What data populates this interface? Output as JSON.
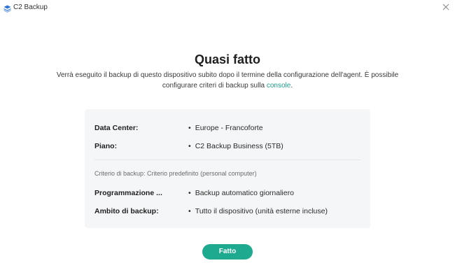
{
  "window": {
    "title": "C2 Backup",
    "app_icon": "stack-layers-icon",
    "close_icon": "close-icon"
  },
  "main": {
    "heading": "Quasi fatto",
    "subtitle_text": "Verrà eseguito il backup di questo dispositivo subito dopo il termine della configurazione dell'agent. È possibile configurare criteri di backup sulla ",
    "subtitle_link": "console",
    "subtitle_end": "."
  },
  "summary": {
    "rows_top": [
      {
        "label": "Data Center:",
        "value": "Europe - Francoforte"
      },
      {
        "label": "Piano:",
        "value": "C2 Backup Business (5TB)"
      }
    ],
    "criterion": "Criterio di backup: Criterio predefinito (personal computer)",
    "rows_bottom": [
      {
        "label": "Programmazione ...",
        "value": "Backup automatico giornaliero"
      },
      {
        "label": "Ambito di backup:",
        "value": "Tutto il dispositivo (unità esterne incluse)"
      }
    ],
    "bullet": "•"
  },
  "actions": {
    "done_label": "Fatto"
  },
  "colors": {
    "accent": "#1eaa8e",
    "link": "#1e9e8a",
    "card_background": "#f5f6f8",
    "app_icon": "#2f73d9"
  }
}
